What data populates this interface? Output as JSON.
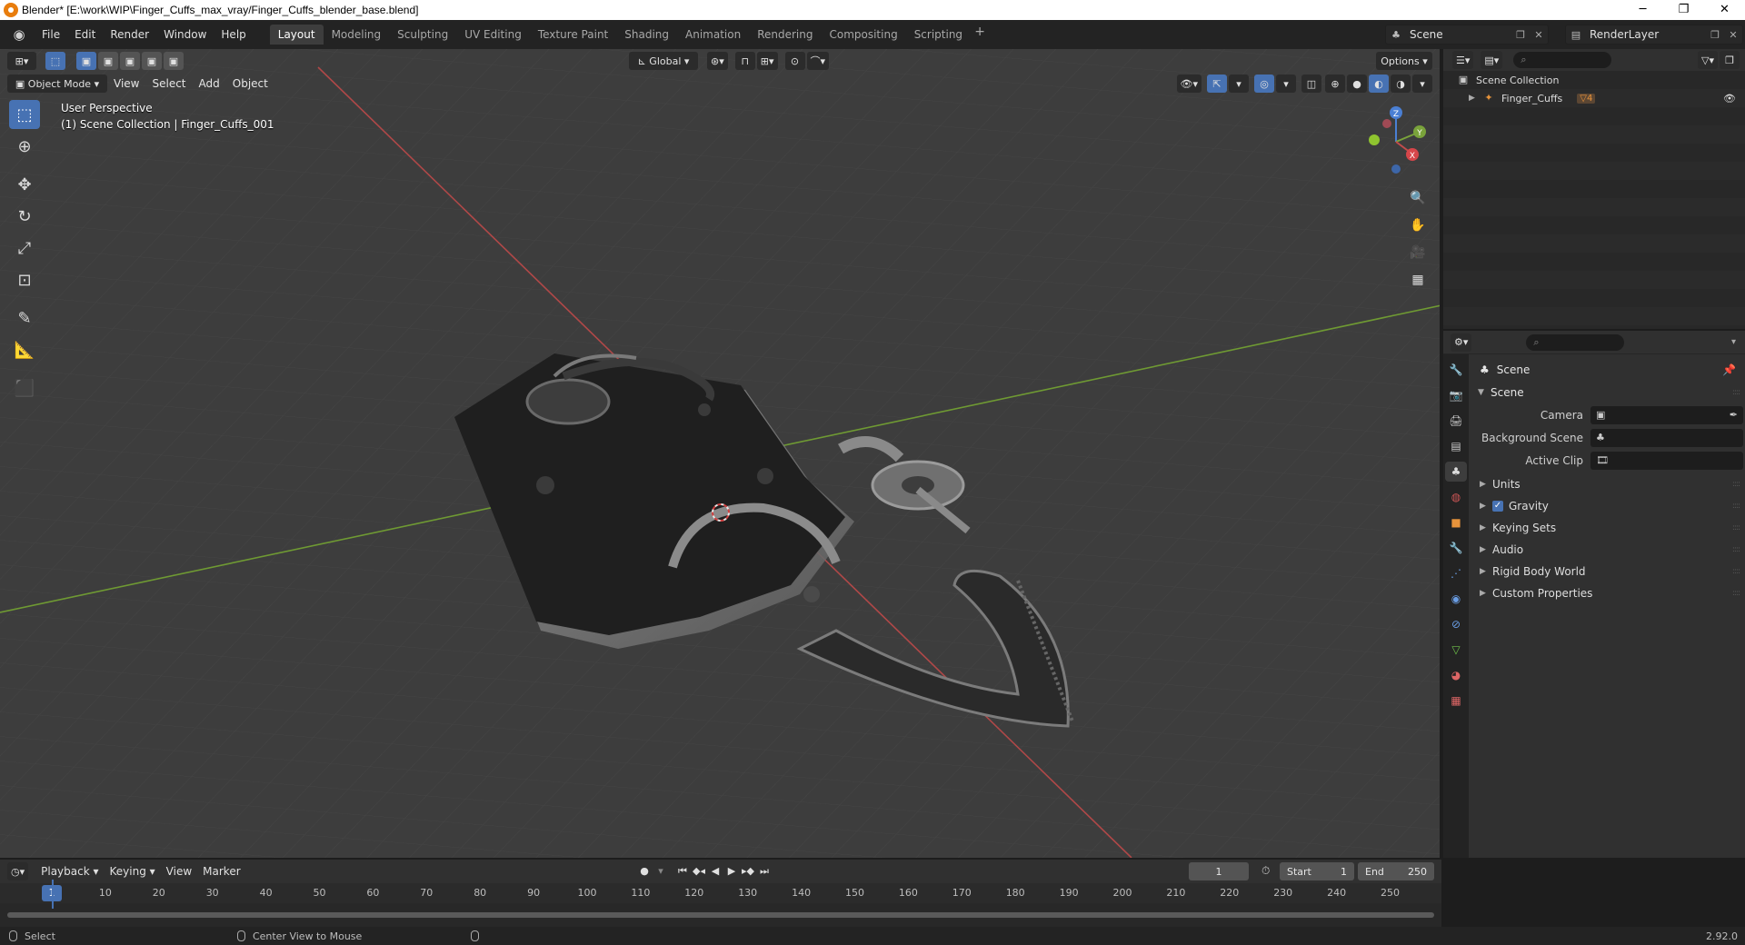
{
  "window": {
    "title": "Blender* [E:\\work\\WIP\\Finger_Cuffs_max_vray/Finger_Cuffs_blender_base.blend]",
    "minimize": "─",
    "maximize": "❐",
    "close": "✕"
  },
  "menu": [
    "File",
    "Edit",
    "Render",
    "Window",
    "Help"
  ],
  "workspaces": [
    "Layout",
    "Modeling",
    "Sculpting",
    "UV Editing",
    "Texture Paint",
    "Shading",
    "Animation",
    "Rendering",
    "Compositing",
    "Scripting"
  ],
  "active_workspace": "Layout",
  "scene_selector": "Scene",
  "view_layer": "RenderLayer",
  "viewport": {
    "mode": "Object Mode",
    "menus": [
      "View",
      "Select",
      "Add",
      "Object"
    ],
    "transform_orientation": "Global",
    "options_label": "Options",
    "info_line1": "User Perspective",
    "info_line2": "(1) Scene Collection | Finger_Cuffs_001",
    "gizmo_axes": {
      "z": "Z",
      "y": "Y",
      "x": "X"
    },
    "accent": "#4772b3",
    "x_axis_color": "#c24c4c",
    "y_axis_color": "#7aa33b"
  },
  "tools": [
    "select-box-tool",
    "cursor-tool",
    "move-tool",
    "rotate-tool",
    "scale-tool",
    "transform-tool",
    "annotate-tool",
    "measure-tool",
    "add-cube-tool"
  ],
  "outliner": {
    "root": "Scene Collection",
    "items": [
      {
        "name": "Finger_Cuffs",
        "badge": "4"
      }
    ]
  },
  "properties": {
    "context": "Scene",
    "panel": "Scene",
    "fields": [
      {
        "label": "Camera",
        "value": ""
      },
      {
        "label": "Background Scene",
        "value": ""
      },
      {
        "label": "Active Clip",
        "value": ""
      }
    ],
    "subpanels": [
      "Units",
      "Gravity",
      "Keying Sets",
      "Audio",
      "Rigid Body World",
      "Custom Properties"
    ],
    "gravity_enabled": true
  },
  "timeline": {
    "menus": [
      "Playback",
      "Keying",
      "View",
      "Marker"
    ],
    "current_frame": "1",
    "start_label": "Start",
    "start": "1",
    "end_label": "End",
    "end": "250",
    "ticks": [
      "10",
      "20",
      "30",
      "40",
      "50",
      "60",
      "70",
      "80",
      "90",
      "100",
      "110",
      "120",
      "130",
      "140",
      "150",
      "160",
      "170",
      "180",
      "190",
      "200",
      "210",
      "220",
      "230",
      "240",
      "250"
    ]
  },
  "status": {
    "left": "Select",
    "middle": "Center View to Mouse",
    "version": "2.92.0"
  }
}
